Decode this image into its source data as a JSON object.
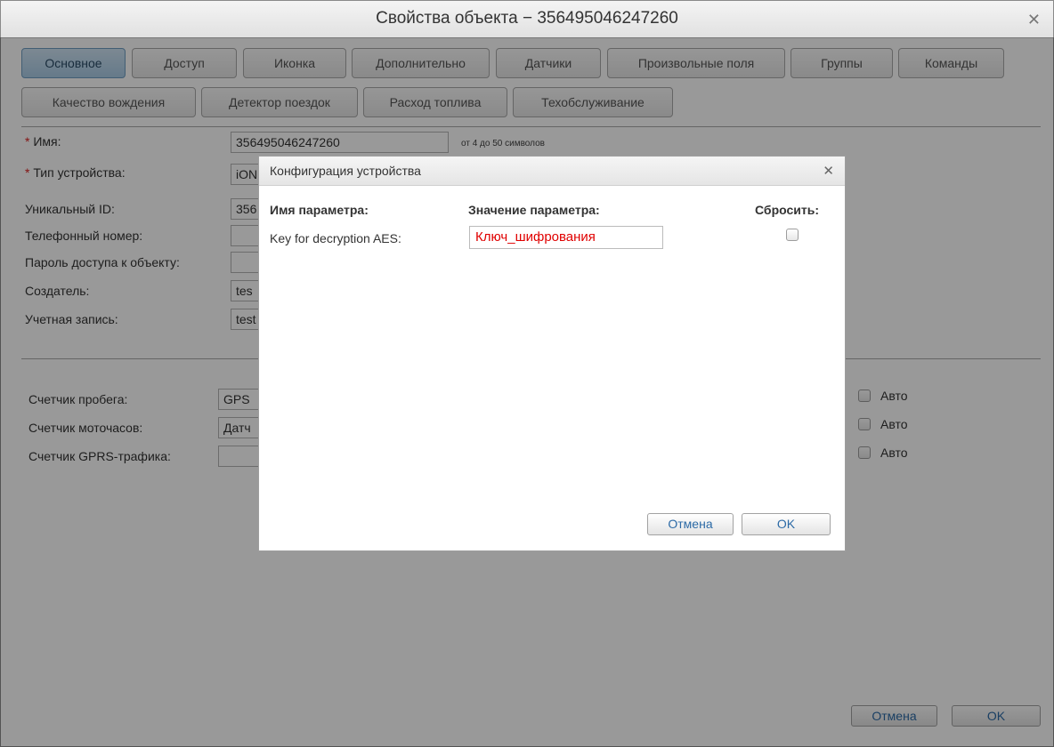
{
  "window": {
    "title": "Свойства объекта − 356495046247260"
  },
  "tabs": [
    {
      "label": "Основное"
    },
    {
      "label": "Доступ"
    },
    {
      "label": "Иконка"
    },
    {
      "label": "Дополнительно"
    },
    {
      "label": "Датчики"
    },
    {
      "label": "Произвольные поля"
    },
    {
      "label": "Группы"
    },
    {
      "label": "Команды"
    },
    {
      "label": "Качество вождения"
    },
    {
      "label": "Детектор поездок"
    },
    {
      "label": "Расход топлива"
    },
    {
      "label": "Техобслуживание"
    }
  ],
  "form": {
    "name": {
      "label": "Имя:",
      "value": "356495046247260",
      "hint": "от 4 до 50 символов"
    },
    "device_type": {
      "label": "Тип устройства:",
      "value": "iON"
    },
    "unique_id": {
      "label": "Уникальный ID:",
      "value": "356"
    },
    "phone": {
      "label": "Телефонный номер:",
      "value": ""
    },
    "password": {
      "label": "Пароль доступа к объекту:",
      "value": ""
    },
    "creator": {
      "label": "Создатель:",
      "value": "tes"
    },
    "account": {
      "label": "Учетная запись:",
      "value": "test"
    },
    "required_mark": "*"
  },
  "counters": {
    "mileage": {
      "label": "Счетчик пробега:",
      "value": "GPS",
      "auto": "Авто"
    },
    "engine_hours": {
      "label": "Счетчик моточасов:",
      "value": "Датч",
      "auto": "Авто"
    },
    "gprs": {
      "label": "Счетчик GPRS-трафика:",
      "value": "",
      "auto": "Авто"
    }
  },
  "footer": {
    "cancel": "Отмена",
    "ok": "OK"
  },
  "modal": {
    "title": "Конфигурация устройства",
    "col_name": "Имя параметра:",
    "col_value": "Значение параметра:",
    "col_reset": "Сбросить:",
    "param_label": "Key for decryption AES:",
    "param_value": "Ключ_шифрования",
    "cancel": "Отмена",
    "ok": "OK"
  }
}
